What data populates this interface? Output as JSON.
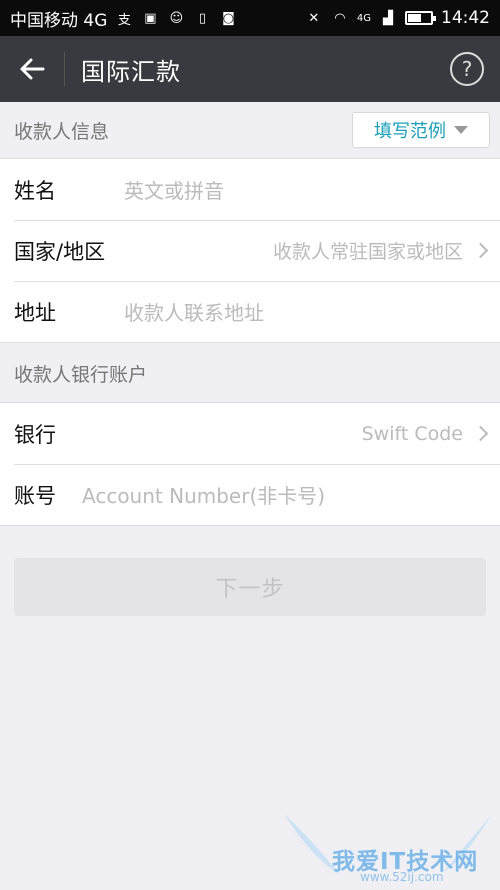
{
  "status_bar": {
    "carrier": "中国移动 4G",
    "network_badge": "4G",
    "time": "14:42",
    "battery_level": 0.6
  },
  "header": {
    "title": "国际汇款",
    "help_label": "?"
  },
  "recipient_section": {
    "title": "收款人信息",
    "example_button": "填写范例",
    "fields": [
      {
        "label": "姓名",
        "placeholder": "英文或拼音"
      },
      {
        "label": "国家/地区",
        "placeholder": "收款人常驻国家或地区"
      },
      {
        "label": "地址",
        "placeholder": "收款人联系地址"
      }
    ]
  },
  "bank_section": {
    "title": "收款人银行账户",
    "fields": [
      {
        "label": "银行",
        "placeholder": "Swift Code"
      },
      {
        "label": "账号",
        "placeholder": "Account Number(非卡号)"
      }
    ]
  },
  "actions": {
    "next_label": "下一步"
  },
  "watermark": {
    "text": "我爱IT技术网",
    "url": "www.52ij.com"
  }
}
